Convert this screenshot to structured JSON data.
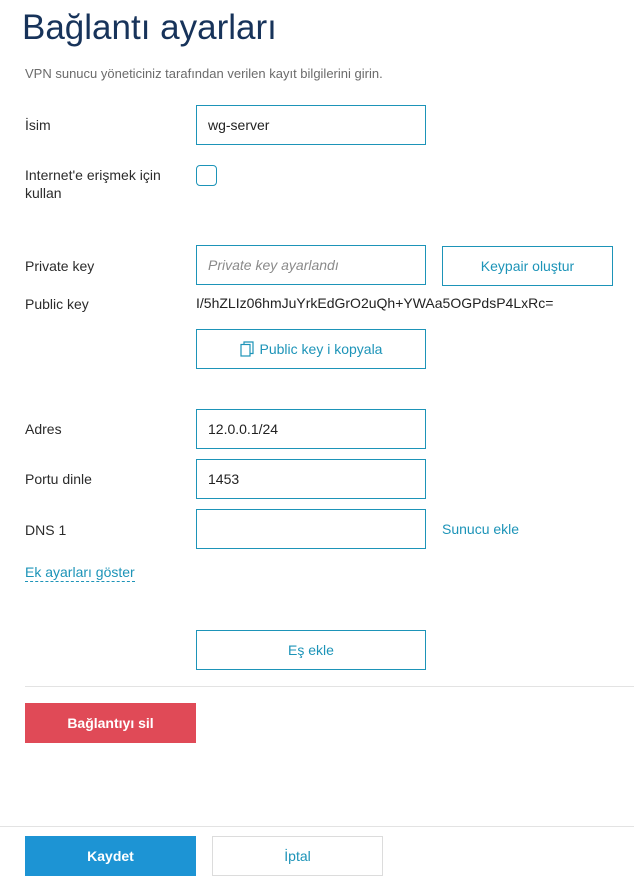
{
  "page": {
    "title": "Bağlantı ayarları",
    "subtitle": "VPN sunucu yöneticiniz tarafından verilen kayıt bilgilerini girin."
  },
  "form": {
    "name": {
      "label": "İsim",
      "value": "wg-server"
    },
    "internet": {
      "label": "Internet'e erişmek için kullan",
      "checked": false
    },
    "private_key": {
      "label": "Private key",
      "placeholder": "Private key ayarlandı",
      "value": ""
    },
    "keypair_button": "Keypair oluştur",
    "public_key": {
      "label": "Public key",
      "value": "I/5hZLIz06hmJuYrkEdGrO2uQh+YWAa5OGPdsP4LxRc="
    },
    "copy_public_key_button": "Public key i kopyala",
    "address": {
      "label": "Adres",
      "value": "12.0.0.1/24"
    },
    "listen_port": {
      "label": "Portu dinle",
      "value": "1453"
    },
    "dns1": {
      "label": "DNS 1",
      "value": ""
    },
    "add_server_link": "Sunucu ekle",
    "more_settings_link": "Ek ayarları göster",
    "add_peer_button": "Eş ekle"
  },
  "actions": {
    "delete_connection": "Bağlantıyı sil",
    "save": "Kaydet",
    "cancel": "İptal"
  },
  "colors": {
    "accent": "#1d94b8",
    "title": "#17335a",
    "danger": "#e04a57",
    "primary": "#1d94d4"
  },
  "icons": {
    "copy": "copy-icon"
  }
}
